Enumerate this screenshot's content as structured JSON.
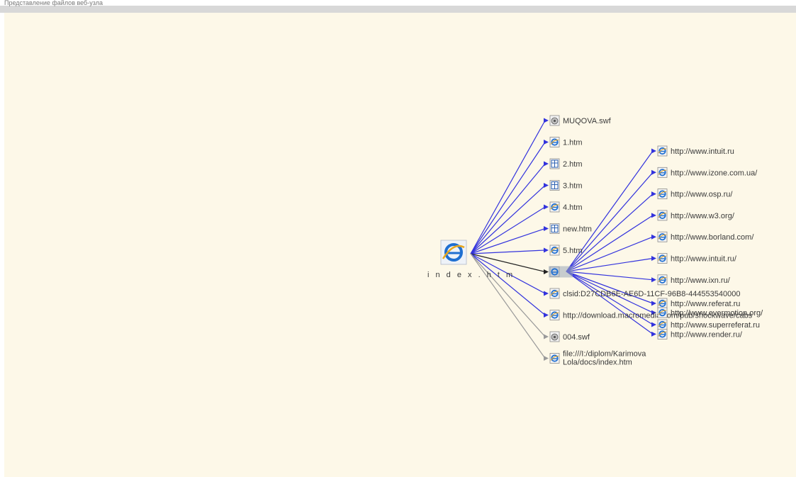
{
  "top_caption": "Представление файлов веб-узла",
  "colors": {
    "background": "#fdf8e8",
    "link_blue": "#3333dd",
    "link_gray": "#9a9a9a",
    "link_black": "#222222",
    "top_bar": "#d8d8d8"
  },
  "root": {
    "label": "i n d e x . h t m",
    "icon": "ie-icon"
  },
  "level1": [
    {
      "label": "MUQOVA.swf",
      "icon": "flash-file-icon",
      "link": "blue"
    },
    {
      "label": "1.htm",
      "icon": "web-page-icon",
      "link": "blue"
    },
    {
      "label": "2.htm",
      "icon": "frames-page-icon",
      "link": "blue"
    },
    {
      "label": "3.htm",
      "icon": "frames-page-icon",
      "link": "blue"
    },
    {
      "label": "4.htm",
      "icon": "web-page-icon",
      "link": "blue"
    },
    {
      "label": "new.htm",
      "icon": "frames-page-icon",
      "link": "blue"
    },
    {
      "label": "5.htm",
      "icon": "web-page-icon",
      "link": "blue"
    },
    {
      "label": "",
      "icon": "selected-page-icon",
      "link": "black"
    },
    {
      "label": "clsid:D27CDB6E-AE6D-11CF-96B8-444553540000",
      "icon": "web-page-icon",
      "link": "blue"
    },
    {
      "label": "http://download.macromedia.com/pub/shockwave/cabs",
      "icon": "web-page-icon",
      "link": "blue"
    },
    {
      "label": "004.swf",
      "icon": "flash-file-icon",
      "link": "gray"
    },
    {
      "label": "file:///I:/diplom/Karimova Lola/docs/index.htm",
      "icon": "web-page-icon",
      "link": "gray"
    }
  ],
  "level2": [
    {
      "label": "http://www.intuit.ru"
    },
    {
      "label": "http://www.izone.com.ua/"
    },
    {
      "label": "http://www.osp.ru/"
    },
    {
      "label": "http://www.w3.org/"
    },
    {
      "label": "http://www.borland.com/"
    },
    {
      "label": "http://www.intuit.ru/"
    },
    {
      "label": "http://www.ixn.ru/"
    },
    {
      "label": "http://www.referat.ru"
    },
    {
      "label": "http://www.superreferat.ru"
    },
    {
      "label": "http://www.evermotion.org/"
    },
    {
      "label": "http://www.render.ru/"
    }
  ]
}
